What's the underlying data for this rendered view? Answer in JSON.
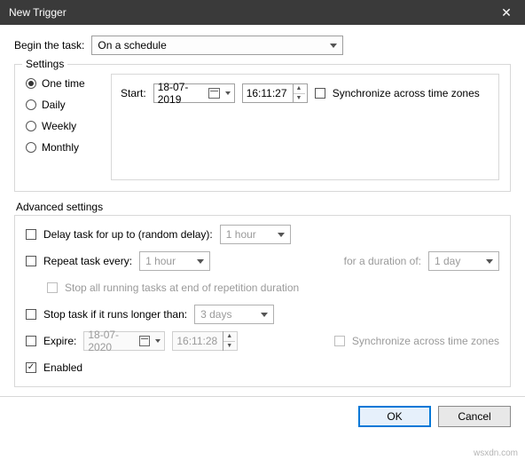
{
  "window": {
    "title": "New Trigger",
    "close": "✕"
  },
  "begin": {
    "label": "Begin the task:",
    "value": "On a schedule"
  },
  "settings": {
    "legend": "Settings",
    "radios": [
      "One time",
      "Daily",
      "Weekly",
      "Monthly"
    ],
    "selected": 0,
    "start_label": "Start:",
    "date": "18-07-2019",
    "time": "16:11:27",
    "sync_label": "Synchronize across time zones",
    "sync_checked": false
  },
  "advanced": {
    "title": "Advanced settings",
    "delay": {
      "label": "Delay task for up to (random delay):",
      "checked": false,
      "value": "1 hour"
    },
    "repeat": {
      "label": "Repeat task every:",
      "checked": false,
      "value": "1 hour",
      "duration_label": "for a duration of:",
      "duration_value": "1 day",
      "stop_label": "Stop all running tasks at end of repetition duration",
      "stop_checked": false
    },
    "stop_task": {
      "label": "Stop task if it runs longer than:",
      "checked": false,
      "value": "3 days"
    },
    "expire": {
      "label": "Expire:",
      "checked": false,
      "date": "18-07-2020",
      "time": "16:11:28",
      "sync_label": "Synchronize across time zones",
      "sync_checked": false
    },
    "enabled": {
      "label": "Enabled",
      "checked": true
    }
  },
  "buttons": {
    "ok": "OK",
    "cancel": "Cancel"
  },
  "watermark": "wsxdn.com"
}
